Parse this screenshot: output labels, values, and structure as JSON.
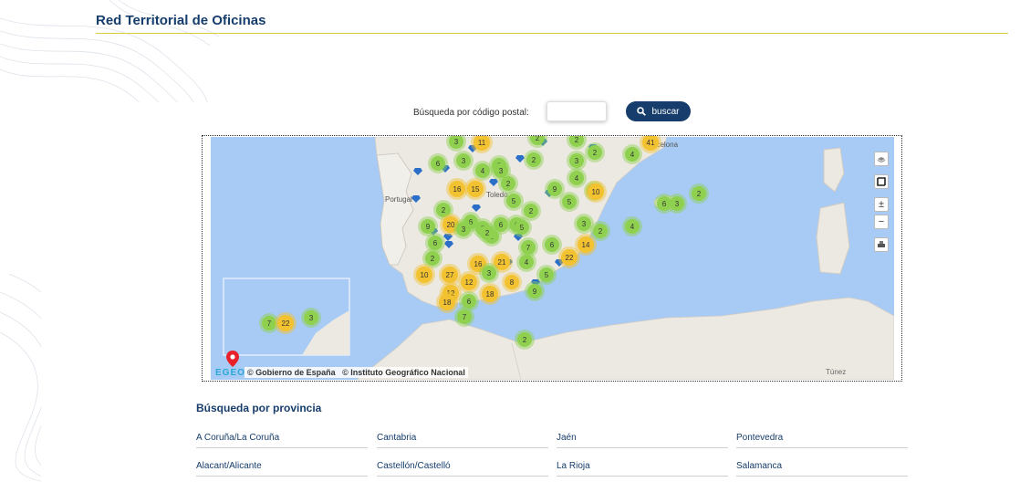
{
  "header": {
    "title": "Red Territorial de Oficinas"
  },
  "search": {
    "label": "Búsqueda por código postal:",
    "input_value": "",
    "button_label": "buscar"
  },
  "map": {
    "attribution_1": "© Gobierno de España",
    "attribution_2": "© Instituto Geográfico Nacional",
    "logo_text": "EGEO",
    "labels": {
      "portugal": "Portugal",
      "toledo": "Toledo",
      "tunez": "Túnez",
      "barcelona": "Barcelona"
    },
    "controls": [
      "layers-icon",
      "frame-icon",
      "zoom-in-icon",
      "zoom-out-icon",
      "print-icon"
    ],
    "colors": {
      "sea": "#a8cbf5",
      "land": "#ece9e2",
      "cluster_green": "#8fd14f",
      "cluster_yellow": "#f2c230",
      "office_marker": "#2b6fc8"
    },
    "clusters": [
      {
        "count": "3",
        "color": "green"
      },
      {
        "count": "11",
        "color": "yellow"
      },
      {
        "count": "2",
        "color": "green"
      },
      {
        "count": "6",
        "color": "green"
      },
      {
        "count": "3",
        "color": "green"
      },
      {
        "count": "4",
        "color": "green"
      },
      {
        "count": "2",
        "color": "green"
      },
      {
        "count": "16",
        "color": "yellow"
      },
      {
        "count": "15",
        "color": "yellow"
      },
      {
        "count": "2",
        "color": "green"
      },
      {
        "count": "3",
        "color": "green"
      },
      {
        "count": "2",
        "color": "green"
      },
      {
        "count": "2",
        "color": "green"
      },
      {
        "count": "3",
        "color": "green"
      },
      {
        "count": "4",
        "color": "green"
      },
      {
        "count": "2",
        "color": "green"
      },
      {
        "count": "9",
        "color": "green"
      },
      {
        "count": "6",
        "color": "green"
      },
      {
        "count": "41",
        "color": "yellow"
      },
      {
        "count": "4",
        "color": "green"
      },
      {
        "count": "5",
        "color": "green"
      },
      {
        "count": "2",
        "color": "green"
      },
      {
        "count": "6",
        "color": "green"
      },
      {
        "count": "2",
        "color": "green"
      },
      {
        "count": "20",
        "color": "yellow"
      },
      {
        "count": "6",
        "color": "green"
      },
      {
        "count": "3",
        "color": "green"
      },
      {
        "count": "2",
        "color": "green"
      },
      {
        "count": "9",
        "color": "green"
      },
      {
        "count": "3",
        "color": "green"
      },
      {
        "count": "2",
        "color": "green"
      },
      {
        "count": "6",
        "color": "green"
      },
      {
        "count": "5",
        "color": "green"
      },
      {
        "count": "5",
        "color": "green"
      },
      {
        "count": "10",
        "color": "yellow"
      },
      {
        "count": "3",
        "color": "green"
      },
      {
        "count": "2",
        "color": "green"
      },
      {
        "count": "14",
        "color": "yellow"
      },
      {
        "count": "4",
        "color": "green"
      },
      {
        "count": "6",
        "color": "green"
      },
      {
        "count": "7",
        "color": "green"
      },
      {
        "count": "6",
        "color": "green"
      },
      {
        "count": "2",
        "color": "green"
      },
      {
        "count": "22",
        "color": "yellow"
      },
      {
        "count": "16",
        "color": "yellow"
      },
      {
        "count": "21",
        "color": "yellow"
      },
      {
        "count": "4",
        "color": "green"
      },
      {
        "count": "10",
        "color": "yellow"
      },
      {
        "count": "27",
        "color": "yellow"
      },
      {
        "count": "3",
        "color": "green"
      },
      {
        "count": "12",
        "color": "yellow"
      },
      {
        "count": "8",
        "color": "yellow"
      },
      {
        "count": "5",
        "color": "green"
      },
      {
        "count": "12",
        "color": "yellow"
      },
      {
        "count": "18",
        "color": "yellow"
      },
      {
        "count": "9",
        "color": "green"
      },
      {
        "count": "18",
        "color": "yellow"
      },
      {
        "count": "6",
        "color": "green"
      },
      {
        "count": "7",
        "color": "green"
      },
      {
        "count": "2",
        "color": "green"
      },
      {
        "count": "6",
        "color": "green"
      },
      {
        "count": "3",
        "color": "green"
      },
      {
        "count": "2",
        "color": "green"
      },
      {
        "count": "7",
        "color": "green"
      },
      {
        "count": "22",
        "color": "yellow"
      },
      {
        "count": "3",
        "color": "green"
      }
    ]
  },
  "provinces": {
    "title": "Búsqueda por provincia",
    "items": [
      "A Coruña/La Coruña",
      "Cantabria",
      "Jaén",
      "Pontevedra",
      "Alacant/Alicante",
      "Castellón/Castelló",
      "La Rioja",
      "Salamanca"
    ]
  }
}
